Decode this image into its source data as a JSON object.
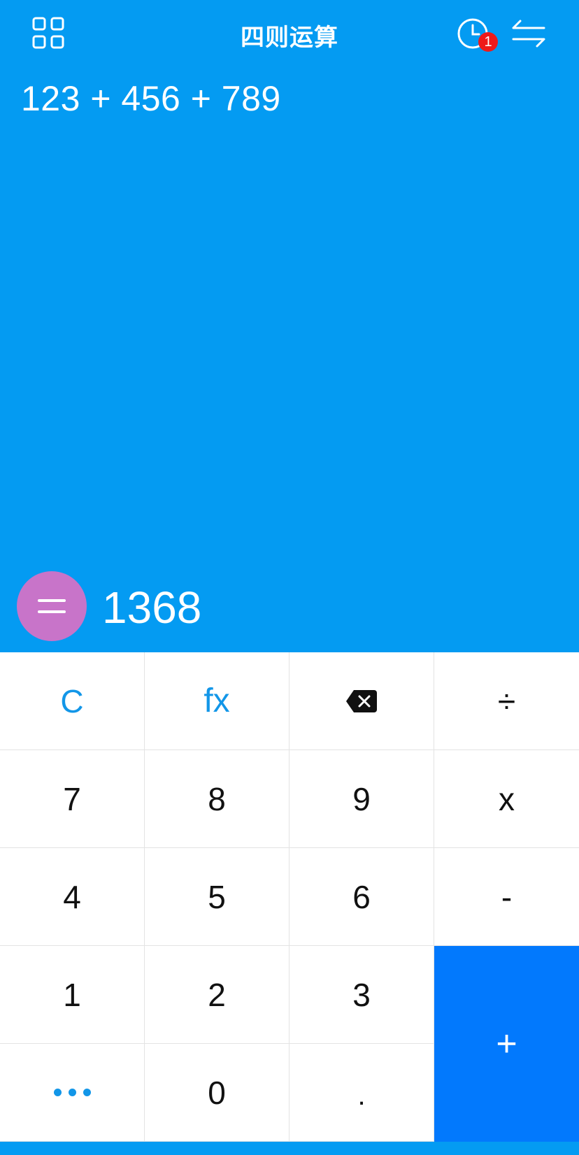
{
  "header": {
    "title": "四则运算",
    "history_badge": "1",
    "menu_icon": "grid-icon",
    "history_icon": "clock-icon",
    "swap_icon": "swap-arrows-icon"
  },
  "display": {
    "expression": "123 + 456 + 789",
    "result": "1368",
    "equals_icon": "equals-icon"
  },
  "keypad": {
    "row1": [
      "C",
      "fx",
      "⌫",
      "÷"
    ],
    "row2": [
      "7",
      "8",
      "9",
      "x"
    ],
    "row3": [
      "4",
      "5",
      "6",
      "-"
    ],
    "row4": [
      "1",
      "2",
      "3"
    ],
    "row5": [
      "...",
      "0",
      "."
    ],
    "plus": "+",
    "backspace_icon": "backspace-icon",
    "more_icon": "more-dots-icon"
  },
  "colors": {
    "display_background": "#049bf2",
    "equals_button": "#c874c9",
    "plus_key": "#0279fd",
    "accent_text": "#1296e8",
    "badge": "#ee1a1a"
  }
}
